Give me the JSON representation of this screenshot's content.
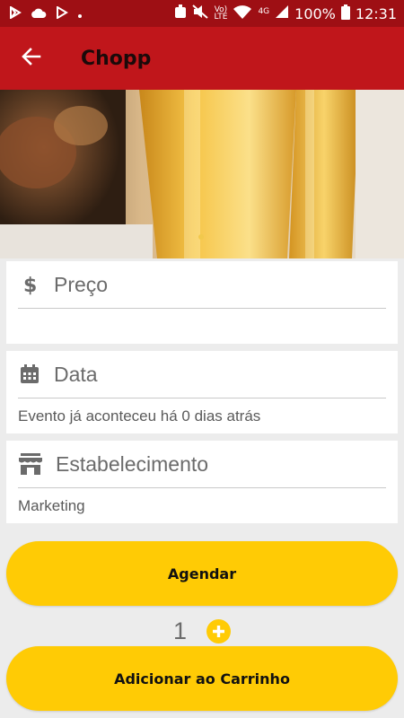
{
  "status_bar": {
    "volte": "Vo)",
    "lte": "LTE",
    "network": "4G",
    "battery": "100%",
    "time": "12:31"
  },
  "header": {
    "title": "Chopp",
    "back_icon": "arrow-left-icon"
  },
  "hero": {
    "image": "beer-glasses-photo"
  },
  "fields": {
    "price": {
      "icon": "dollar-icon",
      "label": "Preço",
      "value": ""
    },
    "date": {
      "icon": "calendar-icon",
      "label": "Data",
      "value": "Evento já aconteceu há 0 dias atrás"
    },
    "establishment": {
      "icon": "store-icon",
      "label": "Estabelecimento",
      "value": "Marketing"
    }
  },
  "actions": {
    "schedule_label": "Agendar",
    "quantity": "1",
    "add_to_cart_label": "Adicionar ao Carrinho"
  },
  "colors": {
    "status_bar": "#9e0f14",
    "app_bar": "#c0161b",
    "accent": "#ffcb05",
    "background": "#ececec"
  }
}
